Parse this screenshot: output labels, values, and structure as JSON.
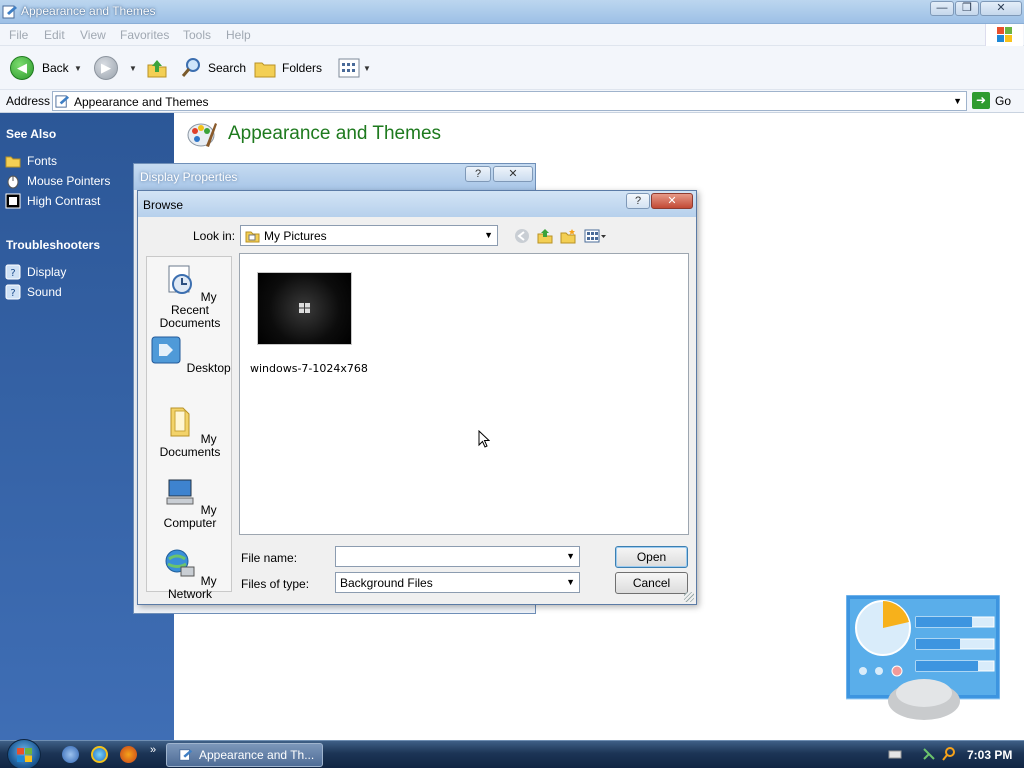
{
  "window": {
    "title": "Appearance and Themes",
    "controls": {
      "minimize": "—",
      "maximize": "❐",
      "close": "✕"
    }
  },
  "menubar": [
    "File",
    "Edit",
    "View",
    "Favorites",
    "Tools",
    "Help"
  ],
  "toolbar": {
    "back": "Back",
    "search": "Search",
    "folders": "Folders"
  },
  "address": {
    "label": "Address",
    "value": "Appearance and Themes",
    "go": "Go"
  },
  "leftpane": {
    "see_also": {
      "title": "See Also",
      "items": [
        "Fonts",
        "Mouse Pointers",
        "High Contrast"
      ]
    },
    "troubleshooters": {
      "title": "Troubleshooters",
      "items": [
        "Display",
        "Sound"
      ]
    }
  },
  "content": {
    "heading": "Appearance and Themes"
  },
  "display_properties": {
    "title": "Display Properties",
    "help": "?",
    "close": "✕"
  },
  "browse": {
    "title": "Browse",
    "help": "?",
    "close": "✕",
    "look_in_label": "Look in:",
    "look_in_value": "My Pictures",
    "places": [
      "My Recent Documents",
      "Desktop",
      "My Documents",
      "My Computer",
      "My Network"
    ],
    "files": [
      {
        "name": "windows-7-1024x768"
      }
    ],
    "file_name_label": "File name:",
    "file_name_value": "",
    "files_of_type_label": "Files of type:",
    "files_of_type_value": "Background Files",
    "open": "Open",
    "cancel": "Cancel"
  },
  "taskbar": {
    "task": "Appearance and Th...",
    "more": "»",
    "clock": "7:03 PM"
  },
  "colors": {
    "left_pane": "#2c5797",
    "heading_green": "#1e7a1e",
    "taskbar": "#1c3556"
  }
}
